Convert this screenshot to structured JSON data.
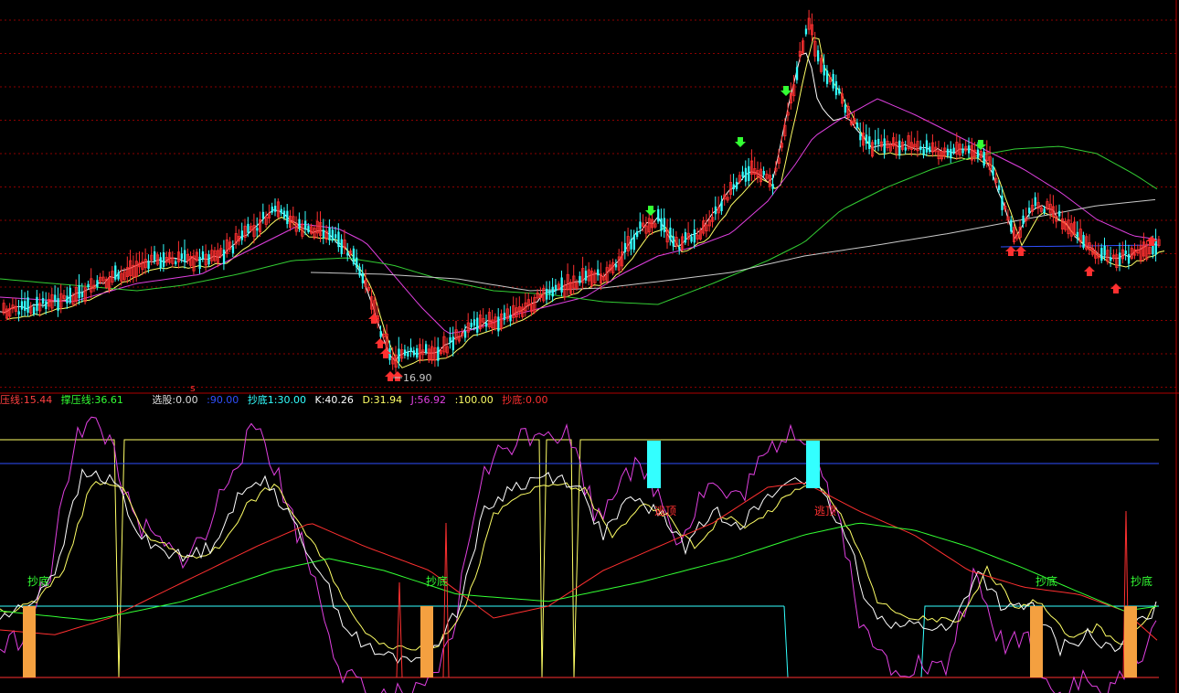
{
  "chart_data": [
    {
      "type": "candlestick",
      "panel": "price",
      "annotations": {
        "low_label": "16.90",
        "buy_marker": "s"
      },
      "signals": {
        "down_arrows": 4,
        "up_arrows": 10
      },
      "series": [
        {
          "name": "MA-short",
          "color": "#ffffff"
        },
        {
          "name": "MA-mid",
          "color": "#ffff66"
        },
        {
          "name": "MA-long",
          "color": "#e040e0"
        },
        {
          "name": "MA-60",
          "color": "#33cc33"
        },
        {
          "name": "MA-120",
          "color": "#c8c8c8"
        },
        {
          "name": "support",
          "color": "#3050ff"
        }
      ]
    },
    {
      "type": "line",
      "panel": "indicator",
      "legend": [
        {
          "label": "压线:15.44",
          "color": "#ff4040"
        },
        {
          "label": "撑压线:36.61",
          "color": "#33ff33"
        },
        {
          "label": "选股:0.00",
          "color": "#dddddd"
        },
        {
          "label": ":90.00",
          "color": "#3050ff"
        },
        {
          "label": "抄底1:30.00",
          "color": "#33ffff"
        },
        {
          "label": "K:40.26",
          "color": "#ffffff"
        },
        {
          "label": "D:31.94",
          "color": "#ffff66"
        },
        {
          "label": "J:56.92",
          "color": "#e040e0"
        },
        {
          "label": ":100.00",
          "color": "#ffff66"
        },
        {
          "label": "抄底:0.00",
          "color": "#ff3030"
        }
      ],
      "reference_levels": {
        "top": 100,
        "blue": 90,
        "cyan": 30,
        "zero": 0
      },
      "labels": {
        "bottom_fishing": "抄底",
        "escape_top": "逃顶"
      }
    }
  ],
  "colors": {
    "background": "#000000",
    "grid": "#8b0000",
    "up": "#ff3030",
    "down": "#33ffff",
    "arrow_up": "#ff3030",
    "arrow_down": "#33ff33",
    "bar_bottom": "#f4a040",
    "bar_top": "#33ffff"
  }
}
